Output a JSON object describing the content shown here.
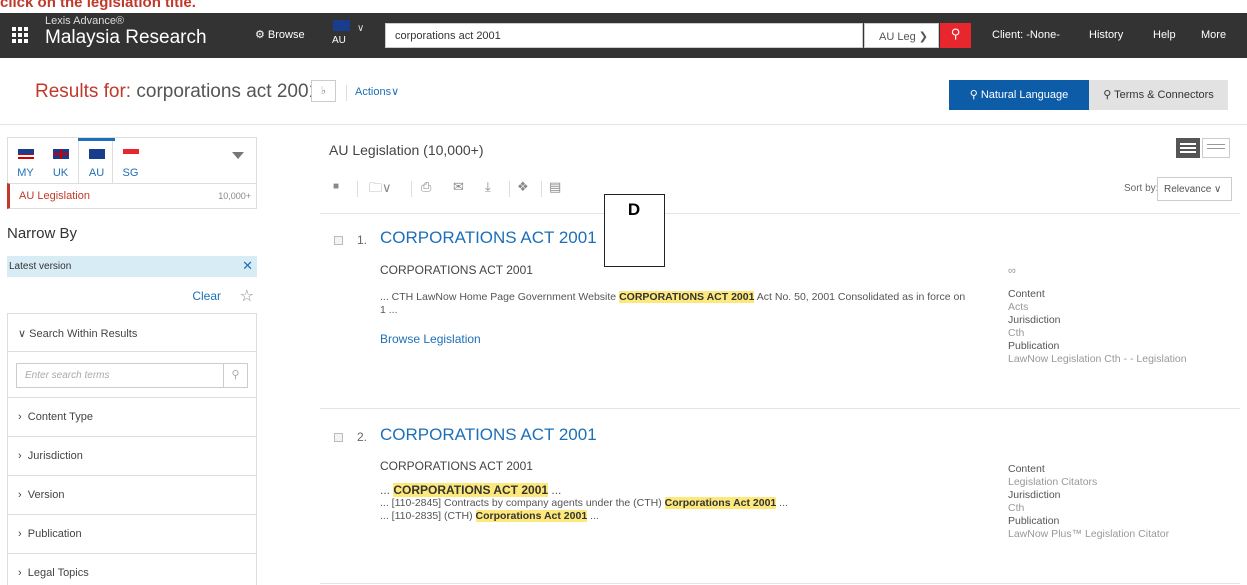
{
  "instruction_text": "click on the legislation title.",
  "topbar": {
    "logo_top": "Lexis Advance®",
    "logo_main": "Malaysia Research",
    "browse": "⚙ Browse",
    "jurisdiction_code": "AU",
    "search_value": "corporations act 2001",
    "search_scope": "AU Leg ❯",
    "client": "Client: -None-",
    "history": "History",
    "help": "Help",
    "more": "More"
  },
  "header": {
    "results_label": "Results for:",
    "query": "corporations act 2001",
    "actions": "Actions∨",
    "natural_language": "⚲ Natural Language",
    "terms_connectors": "⚲ Terms & Connectors"
  },
  "left": {
    "tabs": [
      {
        "code": "MY",
        "color": "#cc0000"
      },
      {
        "code": "UK",
        "color": "#1a3c8c"
      },
      {
        "code": "AU",
        "color": "#1a3c8c"
      },
      {
        "code": "SG",
        "color": "#e8262d"
      }
    ],
    "source_name": "AU Legislation",
    "source_count": "10,000+",
    "narrow_by": "Narrow By",
    "latest_version": "Latest version",
    "clear": "Clear",
    "search_within": "Search Within Results",
    "search_placeholder": "Enter search terms",
    "facets": [
      "Content Type",
      "Jurisdiction",
      "Version",
      "Publication",
      "Legal Topics"
    ]
  },
  "list": {
    "heading": "AU Legislation (10,000+)",
    "sort_label": "Sort by:",
    "sort_value": "Relevance ∨"
  },
  "annotation_label": "D",
  "results": [
    {
      "num": "1.",
      "title": "CORPORATIONS ACT 2001",
      "subtitle": "CORPORATIONS ACT 2001",
      "snip_pre": "... CTH LawNow Home Page Government Website ",
      "snip_hl": "CORPORATIONS ACT 2001",
      "snip_post": "  Act No. 50, 2001 Consolidated as in force on 1 ...",
      "browse_link": "Browse Legislation",
      "content_label": "Content",
      "content_value": "Acts",
      "jurisdiction_label": "Jurisdiction",
      "jurisdiction_value": "Cth",
      "publication_label": "Publication",
      "publication_value": "LawNow Legislation Cth - - Legislation"
    },
    {
      "num": "2.",
      "title": "CORPORATIONS ACT 2001",
      "subtitle": "CORPORATIONS ACT 2001",
      "line1_pre": "... ",
      "line1_hl": "CORPORATIONS ACT 2001",
      "line1_post": " ...",
      "line2_pre": "... [110-2845] Contracts by company agents under the (CTH) ",
      "line2_hl": "Corporations Act 2001",
      "line2_post": " ...",
      "line3_pre": "... [110-2835] (CTH) ",
      "line3_hl": "Corporations Act 2001",
      "line3_post": " ...",
      "content_label": "Content",
      "content_value": "Legislation Citators",
      "jurisdiction_label": "Jurisdiction",
      "jurisdiction_value": "Cth",
      "publication_label": "Publication",
      "publication_value": "LawNow Plus™ Legislation Citator"
    }
  ]
}
